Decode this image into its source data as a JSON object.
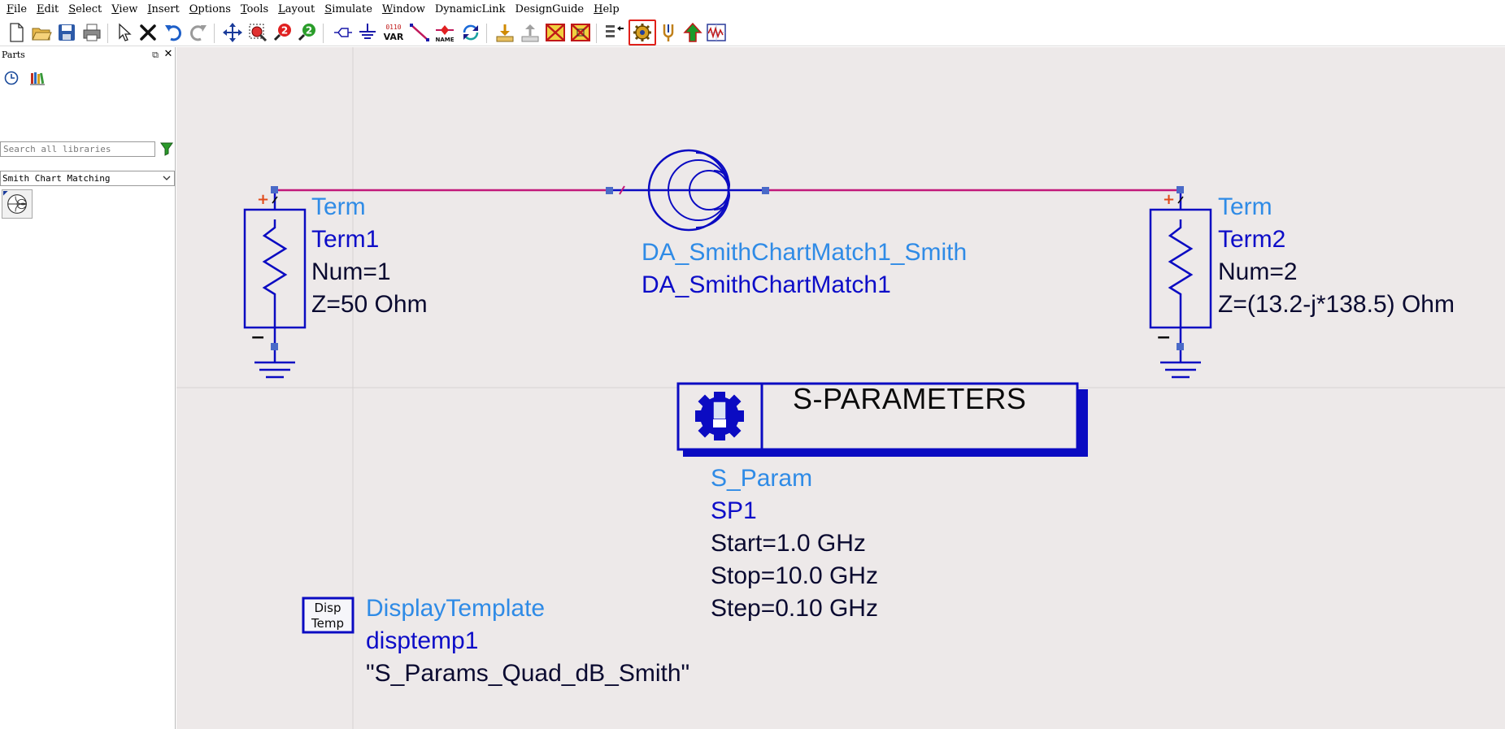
{
  "menubar": {
    "items": [
      {
        "first": "F",
        "rest": "ile"
      },
      {
        "first": "E",
        "rest": "dit"
      },
      {
        "first": "S",
        "rest": "elect"
      },
      {
        "first": "V",
        "rest": "iew"
      },
      {
        "first": "I",
        "rest": "nsert"
      },
      {
        "first": "O",
        "rest": "ptions"
      },
      {
        "first": "T",
        "rest": "ools"
      },
      {
        "first": "L",
        "rest": "ayout"
      },
      {
        "first": "S",
        "rest": "imulate"
      },
      {
        "first": "W",
        "rest": "indow"
      },
      {
        "first": "",
        "rest": "DynamicLink"
      },
      {
        "first": "",
        "rest": "DesignGuide"
      },
      {
        "first": "H",
        "rest": "elp"
      }
    ]
  },
  "toolbar": {
    "var_label": "VAR",
    "var_bits": "0110",
    "name_label": "NAME",
    "highlighted_tool": "simulate-gear-icon"
  },
  "parts_panel": {
    "title": "Parts",
    "search_placeholder": "Search all libraries",
    "library_selected": "Smith Chart Matching"
  },
  "schematic": {
    "term1": {
      "type": "Term",
      "name": "Term1",
      "num": "Num=1",
      "z": "Z=50 Ohm",
      "plus": "+",
      "minus": "−"
    },
    "term2": {
      "type": "Term",
      "name": "Term2",
      "num": "Num=2",
      "z": "Z=(13.2-j*138.5) Ohm",
      "plus": "+",
      "minus": "−"
    },
    "smith": {
      "type": "DA_SmithChartMatch1_Smith",
      "name": "DA_SmithChartMatch1"
    },
    "sparam": {
      "block_title": "S-PARAMETERS",
      "type": "S_Param",
      "name": "SP1",
      "start": "Start=1.0 GHz",
      "stop": "Stop=10.0 GHz",
      "step": "Step=0.10 GHz"
    },
    "disptemp": {
      "icon_line1": "Disp",
      "icon_line2": "Temp",
      "type": "DisplayTemplate",
      "name": "disptemp1",
      "value": "\"S_Params_Quad_dB_Smith\""
    },
    "colors": {
      "wire": "#c2187a",
      "component": "#0b0bc2",
      "label_light": "#2f8be6",
      "label_dark": "#0d0dc8",
      "background": "#ede9e9",
      "highlight": "#e0201a"
    }
  }
}
